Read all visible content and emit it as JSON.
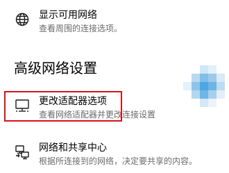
{
  "wifi": {
    "title": "显示可用网络",
    "desc": "查看周围的连接选项。",
    "icon": "globe-icon"
  },
  "advanced": {
    "heading": "高级网络设置"
  },
  "adapter": {
    "title": "更改适配器选项",
    "desc": "查看网络适配器并更改连接设置",
    "icon": "monitor-network-icon"
  },
  "sharing": {
    "title": "网络和共享中心",
    "desc": "根据所连接到的网络，决定要共享的内容。",
    "icon": "sharing-center-icon"
  },
  "colors": {
    "highlight": "#d8121b",
    "desc_text": "#6b6b6b"
  }
}
